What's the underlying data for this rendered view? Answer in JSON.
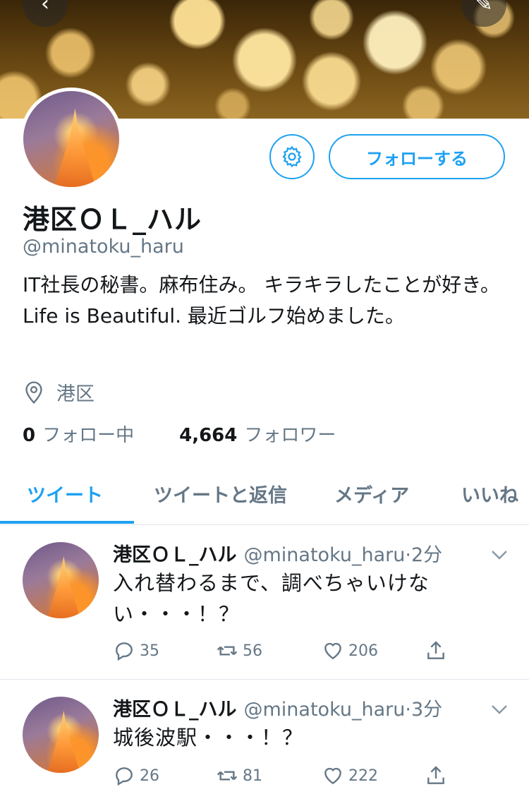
{
  "profile": {
    "display_name": "港区ＯＬ_ハル",
    "handle": "@minatoku_haru",
    "bio": "IT社長の秘書。麻布住み。 キラキラしたことが好き。 Life is Beautiful. 最近ゴルフ始めました。",
    "location": "港区",
    "following_count": "0",
    "following_label": "フォロー中",
    "followers_count": "4,664",
    "followers_label": "フォロワー",
    "follow_button_label": "フォローする"
  },
  "tabs": [
    {
      "label": "ツイート",
      "active": true
    },
    {
      "label": "ツイートと返信",
      "active": false
    },
    {
      "label": "メディア",
      "active": false
    },
    {
      "label": "いいね",
      "active": false
    }
  ],
  "tweets": [
    {
      "name": "港区ＯＬ_ハル",
      "handle": "@minatoku_haru",
      "time": "2分",
      "text": "入れ替わるまで、調べちゃいけない・・・！？",
      "replies": "35",
      "retweets": "56",
      "likes": "206"
    },
    {
      "name": "港区ＯＬ_ハル",
      "handle": "@minatoku_haru",
      "time": "3分",
      "text": "城後波駅・・・！？",
      "replies": "26",
      "retweets": "81",
      "likes": "222"
    }
  ],
  "icons": {
    "back": "back-arrow-icon",
    "share": "share-icon",
    "settings": "gear-icon",
    "location": "location-pin-icon",
    "reply": "reply-icon",
    "retweet": "retweet-icon",
    "like": "heart-icon",
    "share_tweet": "share-up-icon",
    "chevron": "chevron-down-icon"
  },
  "colors": {
    "accent": "#1da1f2",
    "secondary_text": "#657786",
    "divider": "#e1e8ed"
  }
}
